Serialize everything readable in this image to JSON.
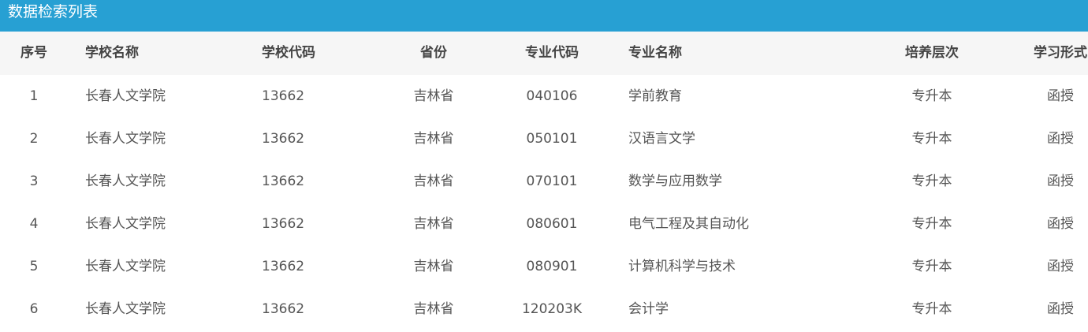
{
  "panel": {
    "title": "数据检索列表"
  },
  "table": {
    "columns": [
      "序号",
      "学校名称",
      "学校代码",
      "省份",
      "专业代码",
      "专业名称",
      "培养层次",
      "学习形式"
    ],
    "rows": [
      [
        "1",
        "长春人文学院",
        "13662",
        "吉林省",
        "040106",
        "学前教育",
        "专升本",
        "函授"
      ],
      [
        "2",
        "长春人文学院",
        "13662",
        "吉林省",
        "050101",
        "汉语言文学",
        "专升本",
        "函授"
      ],
      [
        "3",
        "长春人文学院",
        "13662",
        "吉林省",
        "070101",
        "数学与应用数学",
        "专升本",
        "函授"
      ],
      [
        "4",
        "长春人文学院",
        "13662",
        "吉林省",
        "080601",
        "电气工程及其自动化",
        "专升本",
        "函授"
      ],
      [
        "5",
        "长春人文学院",
        "13662",
        "吉林省",
        "080901",
        "计算机科学与技术",
        "专升本",
        "函授"
      ],
      [
        "6",
        "长春人文学院",
        "13662",
        "吉林省",
        "120203K",
        "会计学",
        "专升本",
        "函授"
      ]
    ]
  },
  "colors": {
    "titlebar": "#27a0d3",
    "header_bg": "#f6f6f6",
    "text": "#555555"
  }
}
